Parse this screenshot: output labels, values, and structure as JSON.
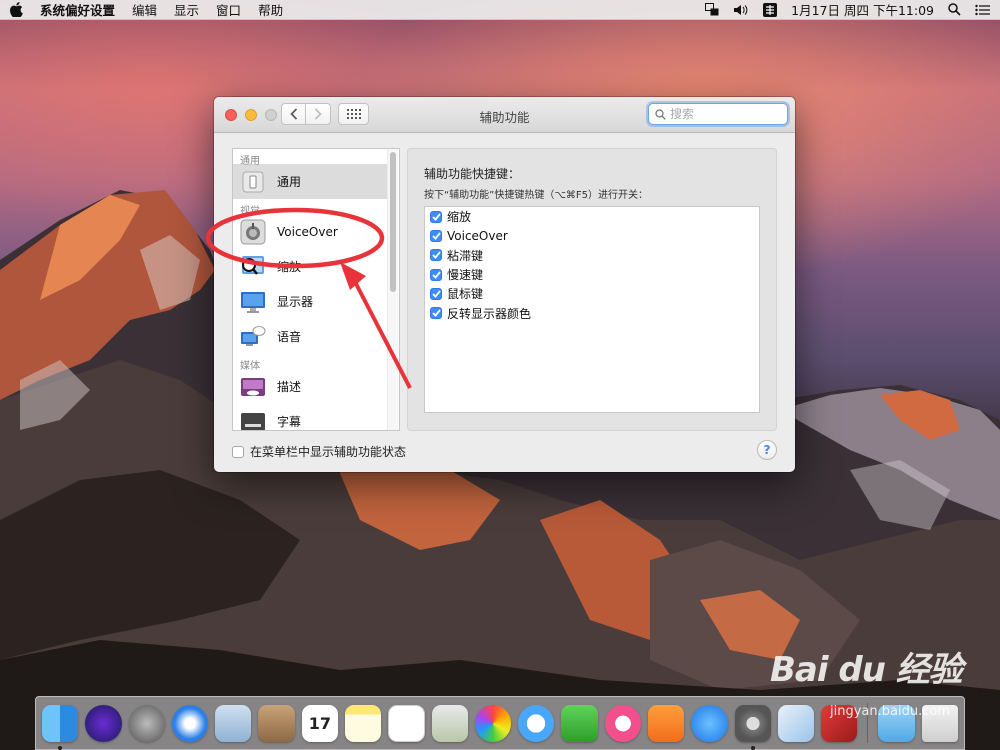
{
  "menubar": {
    "app": "系统偏好设置",
    "menus": [
      "编辑",
      "显示",
      "窗口",
      "帮助"
    ],
    "clock": "1月17日 周四 下午11:09"
  },
  "window": {
    "title": "辅助功能",
    "search_placeholder": "搜索"
  },
  "sidebar": {
    "sections": [
      {
        "label": "通用",
        "items": [
          {
            "label": "通用",
            "icon": "general-icon",
            "selected": true
          }
        ]
      },
      {
        "label": "视觉",
        "items": [
          {
            "label": "VoiceOver",
            "icon": "voiceover-icon"
          },
          {
            "label": "缩放",
            "icon": "zoom-icon"
          },
          {
            "label": "显示器",
            "icon": "display-icon"
          },
          {
            "label": "语音",
            "icon": "speech-icon"
          }
        ]
      },
      {
        "label": "媒体",
        "items": [
          {
            "label": "描述",
            "icon": "descriptions-icon"
          },
          {
            "label": "字幕",
            "icon": "captions-icon"
          }
        ]
      }
    ]
  },
  "panel": {
    "title": "辅助功能快捷键：",
    "subtitle": "按下“辅助功能”快捷键热键（⌥⌘F5）进行开关：",
    "options": [
      {
        "label": "缩放",
        "checked": true
      },
      {
        "label": "VoiceOver",
        "checked": true
      },
      {
        "label": "粘滞键",
        "checked": true
      },
      {
        "label": "慢速键",
        "checked": true
      },
      {
        "label": "鼠标键",
        "checked": true
      },
      {
        "label": "反转显示器颜色",
        "checked": true
      }
    ]
  },
  "footer": {
    "show_status_label": "在菜单栏中显示辅助功能状态",
    "help": "?"
  },
  "dock": {
    "calendar_day": "17"
  },
  "watermark": {
    "main": "Bai du 经验",
    "sub": "jingyan.baidu.com"
  },
  "colors": {
    "accent": "#3d8df7",
    "annotation": "#e8333a"
  }
}
